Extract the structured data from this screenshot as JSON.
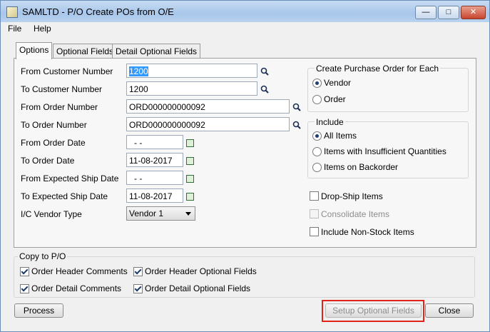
{
  "window": {
    "title": "SAMLTD - P/O Create POs from O/E",
    "min_glyph": "—",
    "max_glyph": "□",
    "close_glyph": "✕"
  },
  "menu": [
    "File",
    "Help"
  ],
  "tabs": [
    "Options",
    "Optional Fields",
    "Detail Optional Fields"
  ],
  "fields": {
    "from_customer": {
      "label": "From Customer Number",
      "value": "1200"
    },
    "to_customer": {
      "label": "To Customer Number",
      "value": "1200"
    },
    "from_order": {
      "label": "From Order Number",
      "value": "ORD000000000092"
    },
    "to_order": {
      "label": "To Order Number",
      "value": "ORD000000000092"
    },
    "from_order_date": {
      "label": "From Order Date",
      "value": "- -"
    },
    "to_order_date": {
      "label": "To Order Date",
      "value": "11-08-2017"
    },
    "from_ship_date": {
      "label": "From Expected Ship Date",
      "value": "- -"
    },
    "to_ship_date": {
      "label": "To Expected Ship Date",
      "value": "11-08-2017"
    },
    "vendor_type": {
      "label": "I/C Vendor Type",
      "value": "Vendor 1"
    }
  },
  "create_po_group": {
    "title": "Create Purchase Order for Each",
    "options": [
      "Vendor",
      "Order"
    ],
    "selected": "Vendor"
  },
  "include_group": {
    "title": "Include",
    "options": [
      "All Items",
      "Items with Insufficient Quantities",
      "Items on Backorder"
    ],
    "selected": "All Items"
  },
  "checks": {
    "drop_ship": {
      "label": "Drop-Ship Items",
      "checked": false
    },
    "consolidate": {
      "label": "Consolidate Items",
      "checked": false,
      "disabled": true
    },
    "non_stock": {
      "label": "Include Non-Stock Items",
      "checked": false
    }
  },
  "copy_group": {
    "title": "Copy to P/O",
    "items": [
      {
        "label": "Order Header Comments",
        "checked": true
      },
      {
        "label": "Order Header Optional Fields",
        "checked": true
      },
      {
        "label": "Order Detail Comments",
        "checked": true
      },
      {
        "label": "Order Detail Optional Fields",
        "checked": true
      }
    ]
  },
  "buttons": {
    "process": "Process",
    "setup_optional_fields": "Setup Optional Fields",
    "close": "Close"
  },
  "colors": {
    "highlight": "#e2231a",
    "title_bar": "#b9d2ef"
  }
}
